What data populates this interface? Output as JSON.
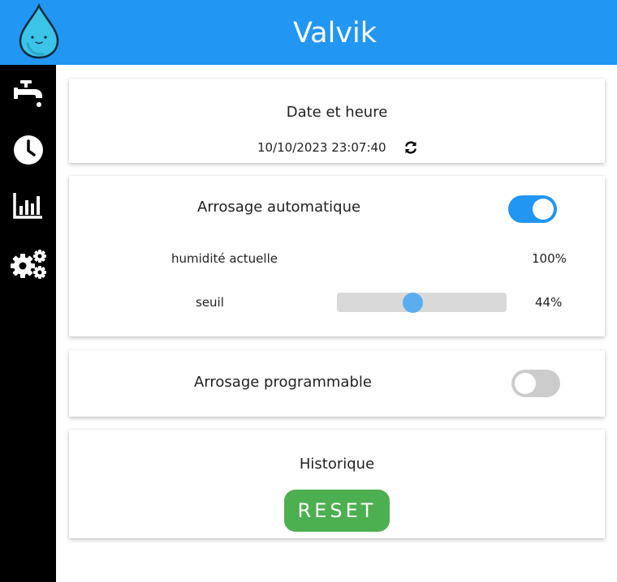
{
  "header": {
    "title": "Valvik",
    "logo_icon": "water-drop-mascot-icon",
    "background_color": "#2196F3"
  },
  "sidebar": {
    "items": [
      {
        "icon": "faucet-icon"
      },
      {
        "icon": "clock-icon"
      },
      {
        "icon": "chart-icon"
      },
      {
        "icon": "gears-icon"
      }
    ]
  },
  "datetime": {
    "title": "Date et heure",
    "value": "10/10/2023 23:07:40",
    "refresh_icon": "refresh-icon"
  },
  "auto_watering": {
    "title": "Arrosage automatique",
    "enabled": true,
    "humidity_label": "humidité actuelle",
    "humidity_value": "100%",
    "threshold_label": "seuil",
    "threshold_value": "44%",
    "threshold_fraction": 0.44,
    "toggle_on_color": "#2196F3"
  },
  "scheduled_watering": {
    "title": "Arrosage programmable",
    "enabled": false,
    "toggle_off_color": "#cccccc"
  },
  "history": {
    "title": "Historique",
    "reset_label": "RESET",
    "reset_color": "#4CAF50"
  }
}
